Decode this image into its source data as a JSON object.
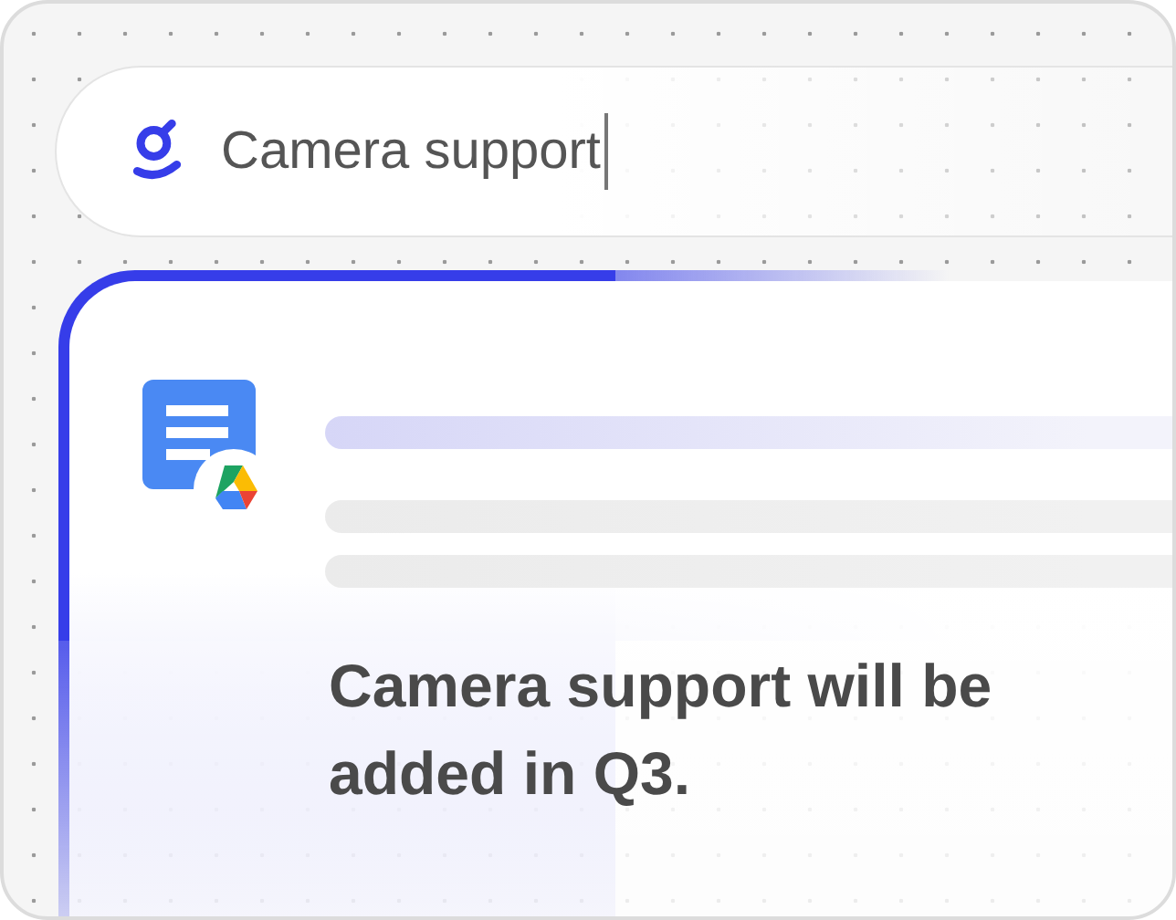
{
  "search": {
    "value": "Camera support"
  },
  "answer": {
    "text": "Camera support will be added in Q3."
  }
}
